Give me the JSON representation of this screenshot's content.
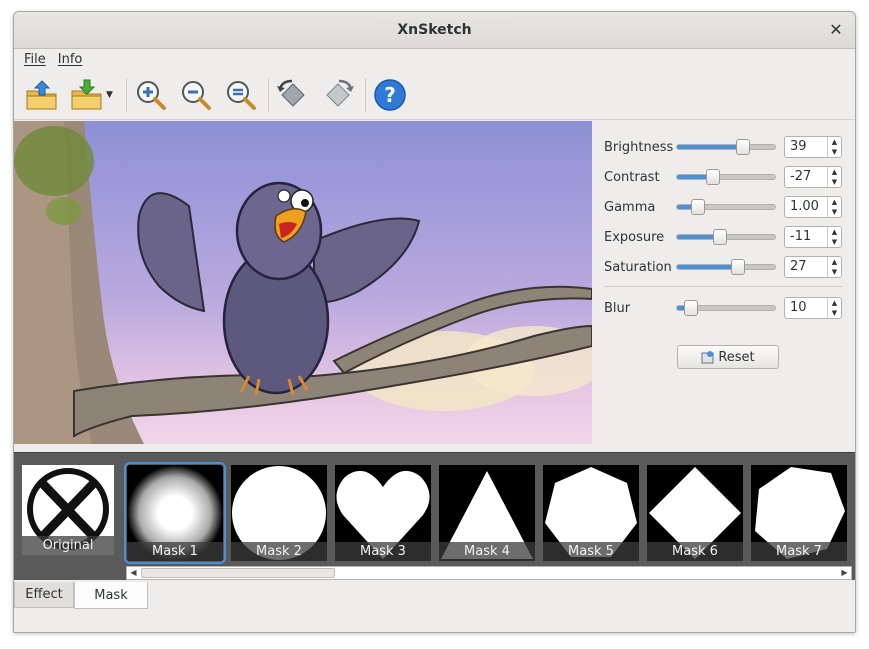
{
  "window": {
    "title": "XnSketch",
    "close_glyph": "✕"
  },
  "menu": {
    "items": [
      "File",
      "Info"
    ]
  },
  "toolbar": {
    "buttons": [
      {
        "name": "open-icon"
      },
      {
        "name": "save-icon"
      },
      {
        "name": "zoom-in-icon"
      },
      {
        "name": "zoom-out-icon"
      },
      {
        "name": "zoom-fit-icon"
      },
      {
        "name": "rotate-left-icon"
      },
      {
        "name": "rotate-right-icon"
      },
      {
        "name": "help-icon"
      }
    ]
  },
  "controls": {
    "brightness": {
      "label": "Brightness",
      "value": "39",
      "level": 0.67
    },
    "contrast": {
      "label": "Contrast",
      "value": "-27",
      "level": 0.37
    },
    "gamma": {
      "label": "Gamma",
      "value": "1.00",
      "level": 0.21
    },
    "exposure": {
      "label": "Exposure",
      "value": "-11",
      "level": 0.44
    },
    "saturation": {
      "label": "Saturation",
      "value": "27",
      "level": 0.62
    },
    "blur": {
      "label": "Blur",
      "value": "10",
      "level": 0.14
    },
    "reset_label": "Reset"
  },
  "masks": {
    "original": "Original",
    "items": [
      "Mask 1",
      "Mask 2",
      "Mask 3",
      "Mask 4",
      "Mask 5",
      "Mask 6",
      "Mask 7"
    ],
    "selected": "Mask 1"
  },
  "tabs": {
    "effect": "Effect",
    "mask": "Mask",
    "active": "Mask"
  },
  "colors": {
    "accent": "#4a90d9",
    "strip": "#5a5a5a",
    "window_bg": "#efedeb"
  }
}
